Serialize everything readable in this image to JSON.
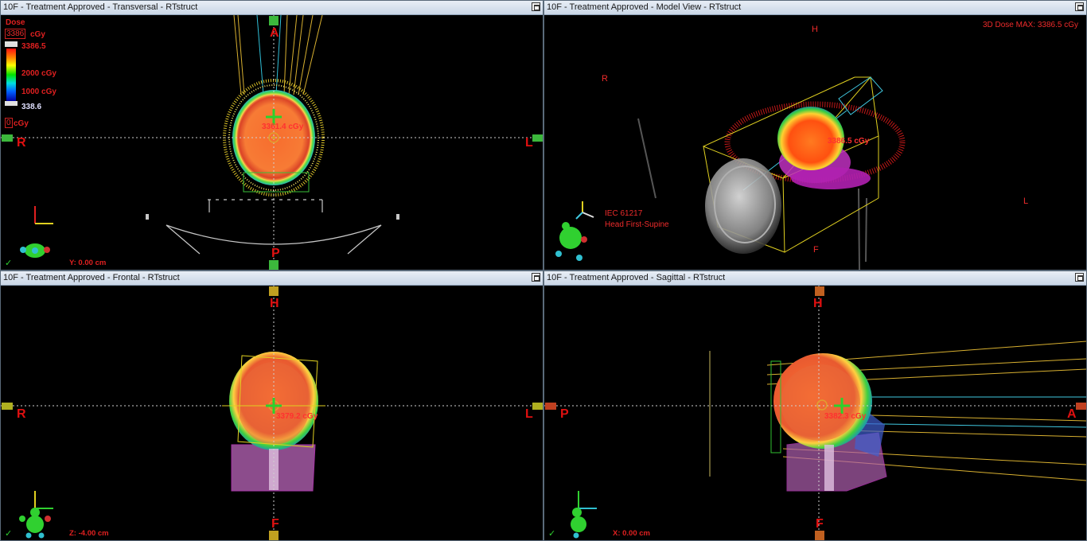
{
  "panes": {
    "transversal": {
      "title": "10F  -  Treatment Approved - Transversal - RTstruct",
      "orient": {
        "top": "A",
        "bottom": "P",
        "left": "R",
        "right": "L"
      },
      "dose_title": "Dose",
      "dose_max_box": "3386",
      "dose_max_unit": "cGy",
      "dose_top_value": "3386.5",
      "dose_2000": "2000 cGy",
      "dose_1000": "1000 cGy",
      "dose_low_value": "338.6",
      "dose_zero_box": "0",
      "dose_zero_unit": "cGy",
      "point_dose": "3361.4 cGy",
      "position": "Y: 0.00 cm",
      "check": "✓"
    },
    "model": {
      "title": "10F  -  Treatment Approved - Model View - RTstruct",
      "max_label": "3D Dose MAX: 3386.5 cGy",
      "orient": {
        "top": "H",
        "left": "R",
        "right": "L",
        "bottom": "F"
      },
      "point_dose": "3386.5 cGy",
      "coord_system": "IEC 61217",
      "patient_orientation": "Head First-Supine"
    },
    "frontal": {
      "title": "10F  -  Treatment Approved - Frontal - RTstruct",
      "orient": {
        "top": "H",
        "bottom": "F",
        "left": "R",
        "right": "L"
      },
      "point_dose": "3379.2 cGy",
      "position": "Z: -4.00 cm",
      "check": "✓"
    },
    "sagittal": {
      "title": "10F  -  Treatment Approved - Sagittal - RTstruct",
      "orient": {
        "top": "H",
        "bottom": "F",
        "left": "P",
        "right": "A"
      },
      "point_dose": "3382.3 cGy",
      "position": "X: 0.00 cm",
      "check": "✓"
    }
  },
  "colors": {
    "orientation_text": "#e01010",
    "dose_text": "#ff3030",
    "isocenter": "#2cd12c"
  }
}
